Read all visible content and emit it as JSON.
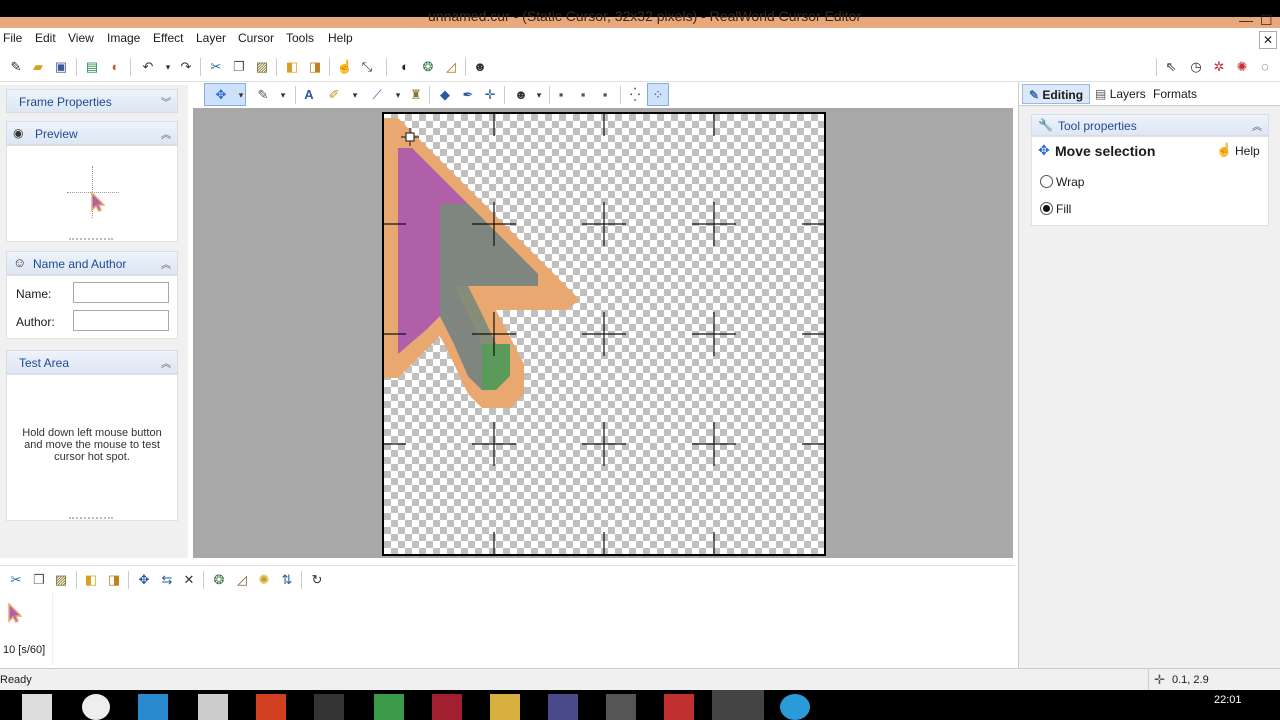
{
  "window": {
    "title": "unnamed.cur - (Static Cursor, 32x32 pixels) - RealWorld Cursor Editor",
    "minimize": "—",
    "maximize": "☐"
  },
  "menu": {
    "items": [
      "File",
      "Edit",
      "View",
      "Image",
      "Effect",
      "Layer",
      "Cursor",
      "Tools",
      "Help"
    ],
    "close_doc": "✕"
  },
  "left_panel": {
    "frame_properties": "Frame Properties",
    "preview": "Preview",
    "name_and_author": "Name and Author",
    "name_label": "Name:",
    "author_label": "Author:",
    "name_value": "",
    "author_value": "",
    "test_area": "Test Area",
    "test_area_hint": "Hold down left mouse button and move the mouse to test cursor hot spot."
  },
  "right_panel": {
    "tabs": [
      "Editing",
      "Layers",
      "Formats"
    ],
    "tool_properties": "Tool properties",
    "tool_name": "Move selection",
    "help": "Help",
    "options": [
      {
        "label": "Wrap",
        "checked": false
      },
      {
        "label": "Fill",
        "checked": true
      }
    ]
  },
  "frames": {
    "frame_label": "10 [s/60]"
  },
  "status": {
    "text": "Ready",
    "coords": "0.1, 2.9"
  },
  "taskbar": {
    "clock": "22:01"
  },
  "colors": {
    "accent": "#1e4a94",
    "cursor_outline": "#e8a870",
    "cursor_fill_top": "#b060a8",
    "cursor_fill_mid": "#7a8a7a",
    "cursor_fill_tail": "#5a9a5a"
  }
}
